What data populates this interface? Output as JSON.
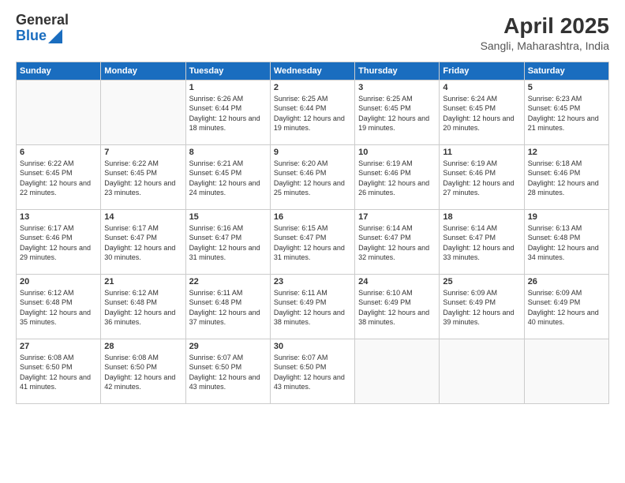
{
  "header": {
    "logo_general": "General",
    "logo_blue": "Blue",
    "title": "April 2025",
    "subtitle": "Sangli, Maharashtra, India"
  },
  "weekdays": [
    "Sunday",
    "Monday",
    "Tuesday",
    "Wednesday",
    "Thursday",
    "Friday",
    "Saturday"
  ],
  "weeks": [
    [
      {
        "day": "",
        "info": ""
      },
      {
        "day": "",
        "info": ""
      },
      {
        "day": "1",
        "info": "Sunrise: 6:26 AM\nSunset: 6:44 PM\nDaylight: 12 hours and 18 minutes."
      },
      {
        "day": "2",
        "info": "Sunrise: 6:25 AM\nSunset: 6:44 PM\nDaylight: 12 hours and 19 minutes."
      },
      {
        "day": "3",
        "info": "Sunrise: 6:25 AM\nSunset: 6:45 PM\nDaylight: 12 hours and 19 minutes."
      },
      {
        "day": "4",
        "info": "Sunrise: 6:24 AM\nSunset: 6:45 PM\nDaylight: 12 hours and 20 minutes."
      },
      {
        "day": "5",
        "info": "Sunrise: 6:23 AM\nSunset: 6:45 PM\nDaylight: 12 hours and 21 minutes."
      }
    ],
    [
      {
        "day": "6",
        "info": "Sunrise: 6:22 AM\nSunset: 6:45 PM\nDaylight: 12 hours and 22 minutes."
      },
      {
        "day": "7",
        "info": "Sunrise: 6:22 AM\nSunset: 6:45 PM\nDaylight: 12 hours and 23 minutes."
      },
      {
        "day": "8",
        "info": "Sunrise: 6:21 AM\nSunset: 6:45 PM\nDaylight: 12 hours and 24 minutes."
      },
      {
        "day": "9",
        "info": "Sunrise: 6:20 AM\nSunset: 6:46 PM\nDaylight: 12 hours and 25 minutes."
      },
      {
        "day": "10",
        "info": "Sunrise: 6:19 AM\nSunset: 6:46 PM\nDaylight: 12 hours and 26 minutes."
      },
      {
        "day": "11",
        "info": "Sunrise: 6:19 AM\nSunset: 6:46 PM\nDaylight: 12 hours and 27 minutes."
      },
      {
        "day": "12",
        "info": "Sunrise: 6:18 AM\nSunset: 6:46 PM\nDaylight: 12 hours and 28 minutes."
      }
    ],
    [
      {
        "day": "13",
        "info": "Sunrise: 6:17 AM\nSunset: 6:46 PM\nDaylight: 12 hours and 29 minutes."
      },
      {
        "day": "14",
        "info": "Sunrise: 6:17 AM\nSunset: 6:47 PM\nDaylight: 12 hours and 30 minutes."
      },
      {
        "day": "15",
        "info": "Sunrise: 6:16 AM\nSunset: 6:47 PM\nDaylight: 12 hours and 31 minutes."
      },
      {
        "day": "16",
        "info": "Sunrise: 6:15 AM\nSunset: 6:47 PM\nDaylight: 12 hours and 31 minutes."
      },
      {
        "day": "17",
        "info": "Sunrise: 6:14 AM\nSunset: 6:47 PM\nDaylight: 12 hours and 32 minutes."
      },
      {
        "day": "18",
        "info": "Sunrise: 6:14 AM\nSunset: 6:47 PM\nDaylight: 12 hours and 33 minutes."
      },
      {
        "day": "19",
        "info": "Sunrise: 6:13 AM\nSunset: 6:48 PM\nDaylight: 12 hours and 34 minutes."
      }
    ],
    [
      {
        "day": "20",
        "info": "Sunrise: 6:12 AM\nSunset: 6:48 PM\nDaylight: 12 hours and 35 minutes."
      },
      {
        "day": "21",
        "info": "Sunrise: 6:12 AM\nSunset: 6:48 PM\nDaylight: 12 hours and 36 minutes."
      },
      {
        "day": "22",
        "info": "Sunrise: 6:11 AM\nSunset: 6:48 PM\nDaylight: 12 hours and 37 minutes."
      },
      {
        "day": "23",
        "info": "Sunrise: 6:11 AM\nSunset: 6:49 PM\nDaylight: 12 hours and 38 minutes."
      },
      {
        "day": "24",
        "info": "Sunrise: 6:10 AM\nSunset: 6:49 PM\nDaylight: 12 hours and 38 minutes."
      },
      {
        "day": "25",
        "info": "Sunrise: 6:09 AM\nSunset: 6:49 PM\nDaylight: 12 hours and 39 minutes."
      },
      {
        "day": "26",
        "info": "Sunrise: 6:09 AM\nSunset: 6:49 PM\nDaylight: 12 hours and 40 minutes."
      }
    ],
    [
      {
        "day": "27",
        "info": "Sunrise: 6:08 AM\nSunset: 6:50 PM\nDaylight: 12 hours and 41 minutes."
      },
      {
        "day": "28",
        "info": "Sunrise: 6:08 AM\nSunset: 6:50 PM\nDaylight: 12 hours and 42 minutes."
      },
      {
        "day": "29",
        "info": "Sunrise: 6:07 AM\nSunset: 6:50 PM\nDaylight: 12 hours and 43 minutes."
      },
      {
        "day": "30",
        "info": "Sunrise: 6:07 AM\nSunset: 6:50 PM\nDaylight: 12 hours and 43 minutes."
      },
      {
        "day": "",
        "info": ""
      },
      {
        "day": "",
        "info": ""
      },
      {
        "day": "",
        "info": ""
      }
    ]
  ]
}
